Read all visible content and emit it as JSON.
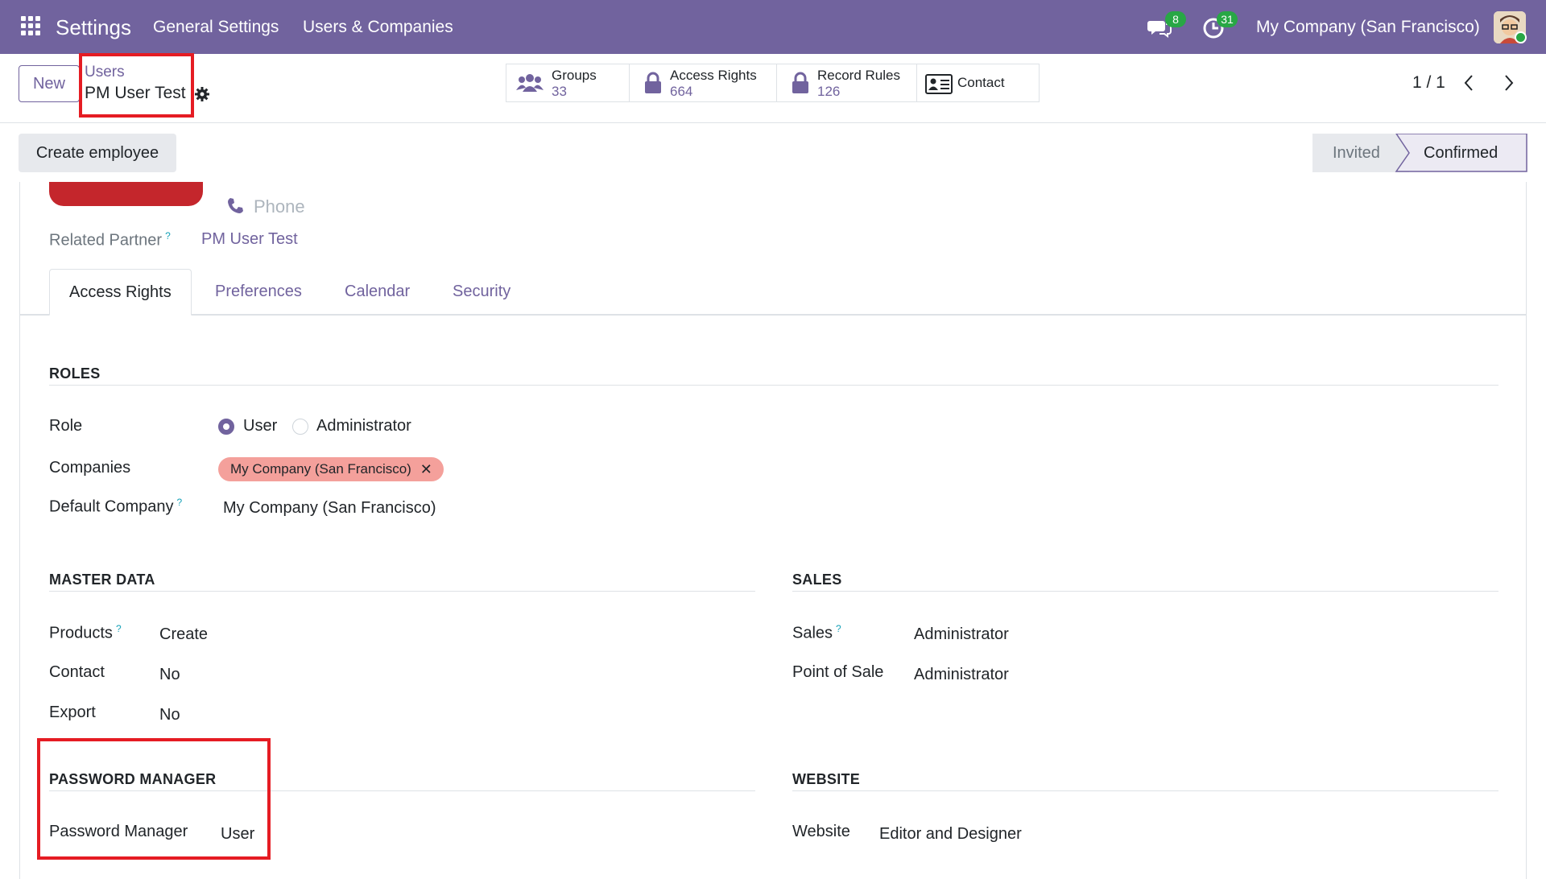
{
  "navbar": {
    "app_title": "Settings",
    "menus": [
      "General Settings",
      "Users & Companies"
    ],
    "messages_count": "8",
    "activities_count": "31",
    "company": "My Company (San Francisco)",
    "bg_color": "#71639e"
  },
  "control_panel": {
    "new_label": "New",
    "breadcrumb_parent": "Users",
    "breadcrumb_current": "PM User Test",
    "smart_buttons": [
      {
        "label": "Groups",
        "value": "33",
        "icon": "users-icon"
      },
      {
        "label": "Access Rights",
        "value": "664",
        "icon": "lock-icon"
      },
      {
        "label": "Record Rules",
        "value": "126",
        "icon": "lock-icon"
      },
      {
        "label": "Contact",
        "value": "",
        "icon": "contact-card-icon"
      }
    ],
    "pager": "1 / 1"
  },
  "status_bar": {
    "create_employee_label": "Create employee",
    "stages": [
      {
        "label": "Invited",
        "active": false
      },
      {
        "label": "Confirmed",
        "active": true
      }
    ]
  },
  "form": {
    "phone_placeholder": "Phone",
    "related_partner_label": "Related Partner",
    "related_partner_value": "PM User Test",
    "tabs": [
      "Access Rights",
      "Preferences",
      "Calendar",
      "Security"
    ],
    "active_tab": "Access Rights",
    "roles": {
      "title": "ROLES",
      "role_label": "Role",
      "role_options": [
        {
          "label": "User",
          "selected": true
        },
        {
          "label": "Administrator",
          "selected": false
        }
      ],
      "companies_label": "Companies",
      "companies_tag": "My Company (San Francisco)",
      "default_company_label": "Default Company",
      "default_company_value": "My Company (San Francisco)"
    },
    "master_data": {
      "title": "MASTER DATA",
      "fields": [
        {
          "label": "Products",
          "value": "Create",
          "help": true
        },
        {
          "label": "Contact",
          "value": "No",
          "help": false
        },
        {
          "label": "Export",
          "value": "No",
          "help": false
        }
      ]
    },
    "sales": {
      "title": "SALES",
      "fields": [
        {
          "label": "Sales",
          "value": "Administrator",
          "help": true
        },
        {
          "label": "Point of Sale",
          "value": "Administrator",
          "help": false
        }
      ]
    },
    "password_manager": {
      "title": "PASSWORD MANAGER",
      "fields": [
        {
          "label": "Password Manager",
          "value": "User"
        }
      ]
    },
    "website": {
      "title": "WEBSITE",
      "fields": [
        {
          "label": "Website",
          "value": "Editor and Designer"
        }
      ]
    },
    "help_mark": "?"
  },
  "colors": {
    "brand": "#71639e",
    "highlight": "#e51c23",
    "tag": "#f4a09b",
    "avatar": "#c4262c"
  }
}
